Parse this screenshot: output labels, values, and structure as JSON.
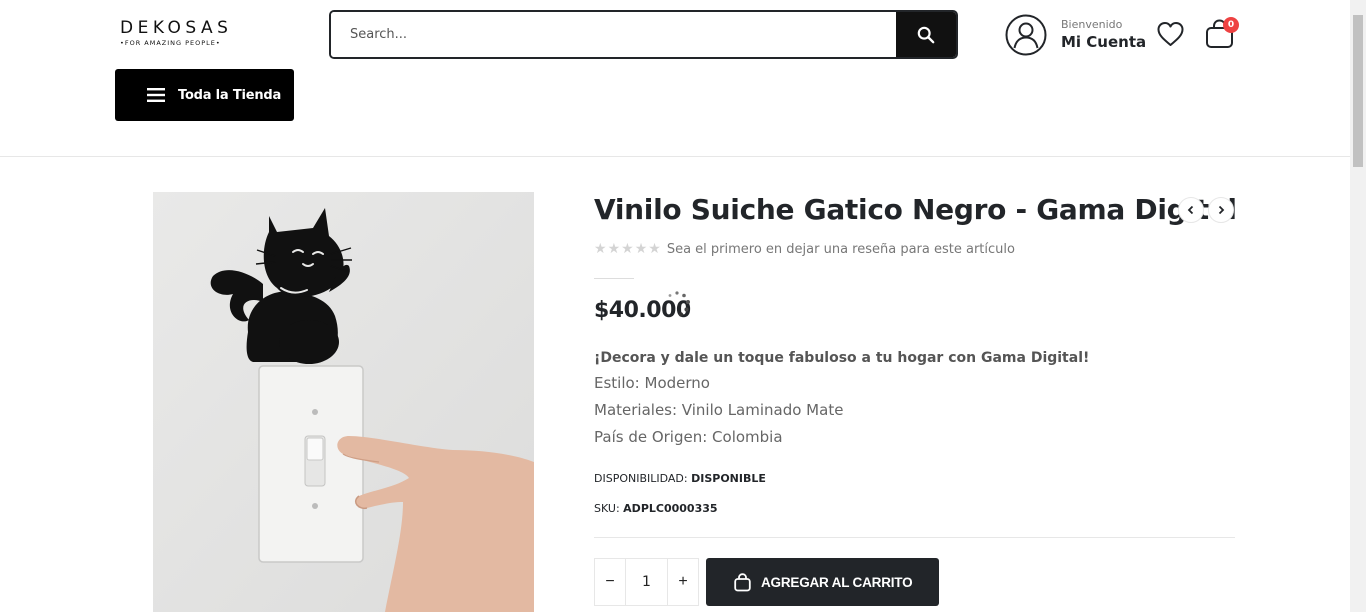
{
  "header": {
    "logo": {
      "name": "DEKOSAS",
      "tagline": "•FOR AMAZING PEOPLE•"
    },
    "search": {
      "placeholder": "Search..."
    },
    "account": {
      "welcome": "Bienvenido",
      "name": "Mi Cuenta"
    },
    "cart": {
      "count": "0"
    },
    "store_button": {
      "label": "Toda la Tienda"
    }
  },
  "product": {
    "title": "Vinilo Suiche Gatico Negro - Gama Digital",
    "review_prompt": "Sea el primero en dejar una reseña para este artículo",
    "rating_stars": 0,
    "price": "$40.000",
    "description": {
      "lead": "¡Decora y dale un toque fabuloso a tu hogar con Gama Digital!",
      "lines": [
        "Estilo: Moderno",
        "Materiales: Vinilo Laminado Mate",
        "País de Origen: Colombia"
      ]
    },
    "availability": {
      "label": "DISPONIBILIDAD:",
      "value": "DISPONIBLE"
    },
    "sku": {
      "label": "SKU:",
      "value": "ADPLC0000335"
    },
    "quantity": {
      "minus": "−",
      "value": "1",
      "plus": "+"
    },
    "add_to_cart": {
      "label": "AGREGAR AL CARRITO"
    }
  },
  "colors": {
    "dark": "#222529",
    "badge": "#ee4242",
    "border": "#e7e7e7",
    "text_muted": "#777777"
  }
}
